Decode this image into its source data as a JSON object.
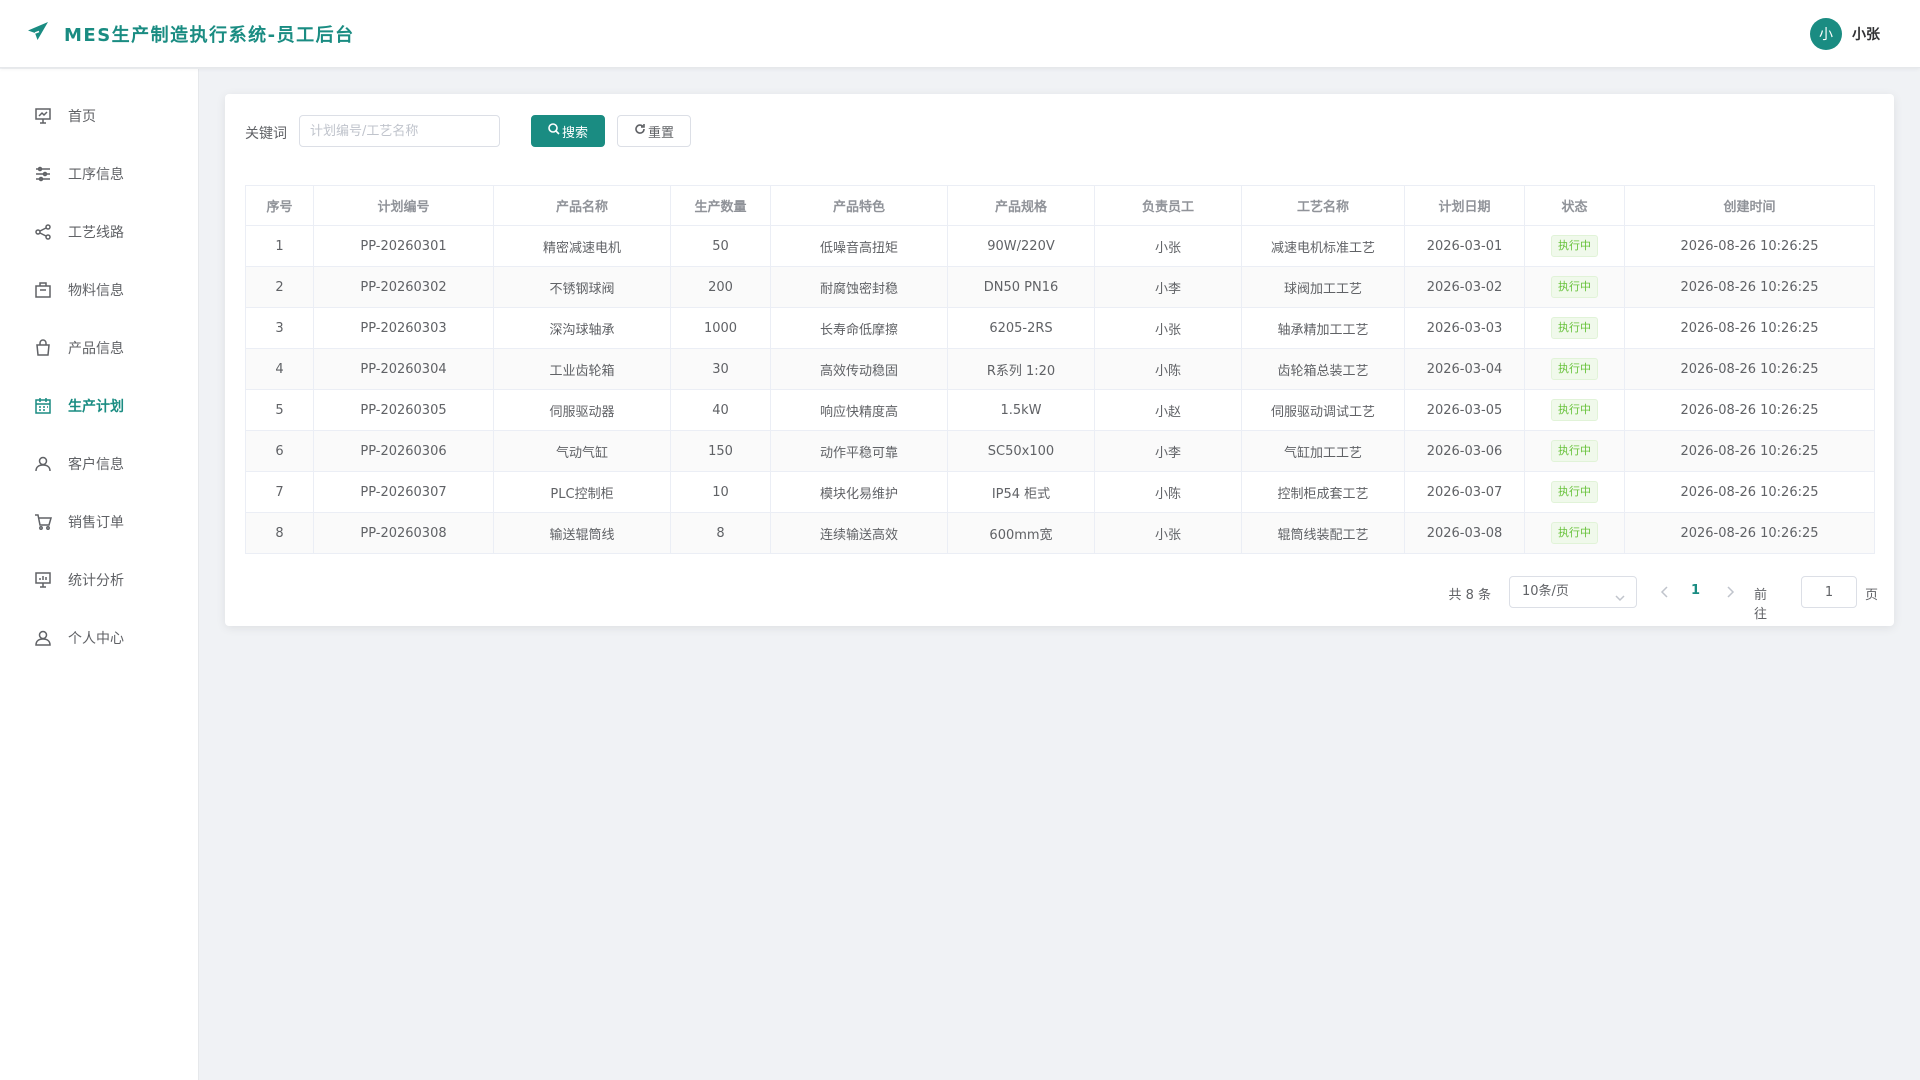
{
  "header": {
    "title": "MES生产制造执行系统-员工后台",
    "logo_icon": "paper-plane-icon",
    "brand_color": "#1a8c82",
    "user": {
      "avatar_text": "小",
      "name": "小张"
    }
  },
  "sidebar": {
    "items": [
      {
        "label": "首页",
        "icon": "presentation-icon",
        "active": false
      },
      {
        "label": "工序信息",
        "icon": "sliders-icon",
        "active": false
      },
      {
        "label": "工艺线路",
        "icon": "share-icon",
        "active": false
      },
      {
        "label": "物料信息",
        "icon": "box-icon",
        "active": false
      },
      {
        "label": "产品信息",
        "icon": "shopping-bag-icon",
        "active": false
      },
      {
        "label": "生产计划",
        "icon": "calendar-icon",
        "active": true
      },
      {
        "label": "客户信息",
        "icon": "user-icon",
        "active": false
      },
      {
        "label": "销售订单",
        "icon": "shopping-cart-icon",
        "active": false
      },
      {
        "label": "统计分析",
        "icon": "chart-board-icon",
        "active": false
      },
      {
        "label": "个人中心",
        "icon": "user-profile-icon",
        "active": false
      }
    ]
  },
  "search": {
    "label": "关键词",
    "placeholder": "计划编号/工艺名称",
    "value": "",
    "search_button": "搜索",
    "reset_button": "重置"
  },
  "table": {
    "columns": [
      "序号",
      "计划编号",
      "产品名称",
      "生产数量",
      "产品特色",
      "产品规格",
      "负责员工",
      "工艺名称",
      "计划日期",
      "状态",
      "创建时间"
    ],
    "rows": [
      [
        "1",
        "PP-20260301",
        "精密减速电机",
        "50",
        "低噪音高扭矩",
        "90W/220V",
        "小张",
        "减速电机标准工艺",
        "2026-03-01",
        "执行中",
        "2026-08-26 10:26:25"
      ],
      [
        "2",
        "PP-20260302",
        "不锈钢球阀",
        "200",
        "耐腐蚀密封稳",
        "DN50 PN16",
        "小李",
        "球阀加工工艺",
        "2026-03-02",
        "执行中",
        "2026-08-26 10:26:25"
      ],
      [
        "3",
        "PP-20260303",
        "深沟球轴承",
        "1000",
        "长寿命低摩擦",
        "6205-2RS",
        "小张",
        "轴承精加工工艺",
        "2026-03-03",
        "执行中",
        "2026-08-26 10:26:25"
      ],
      [
        "4",
        "PP-20260304",
        "工业齿轮箱",
        "30",
        "高效传动稳固",
        "R系列 1:20",
        "小陈",
        "齿轮箱总装工艺",
        "2026-03-04",
        "执行中",
        "2026-08-26 10:26:25"
      ],
      [
        "5",
        "PP-20260305",
        "伺服驱动器",
        "40",
        "响应快精度高",
        "1.5kW",
        "小赵",
        "伺服驱动调试工艺",
        "2026-03-05",
        "执行中",
        "2026-08-26 10:26:25"
      ],
      [
        "6",
        "PP-20260306",
        "气动气缸",
        "150",
        "动作平稳可靠",
        "SC50x100",
        "小李",
        "气缸加工工艺",
        "2026-03-06",
        "执行中",
        "2026-08-26 10:26:25"
      ],
      [
        "7",
        "PP-20260307",
        "PLC控制柜",
        "10",
        "模块化易维护",
        "IP54 柜式",
        "小陈",
        "控制柜成套工艺",
        "2026-03-07",
        "执行中",
        "2026-08-26 10:26:25"
      ],
      [
        "8",
        "PP-20260308",
        "输送辊筒线",
        "8",
        "连续输送高效",
        "600mm宽",
        "小张",
        "辊筒线装配工艺",
        "2026-03-08",
        "执行中",
        "2026-08-26 10:26:25"
      ]
    ],
    "status_color": "#67c23a"
  },
  "pagination": {
    "total_text": "共 8 条",
    "page_size": "10条/页",
    "current_page": "1",
    "goto_label": "前往",
    "goto_value": "1",
    "page_unit": "页"
  }
}
